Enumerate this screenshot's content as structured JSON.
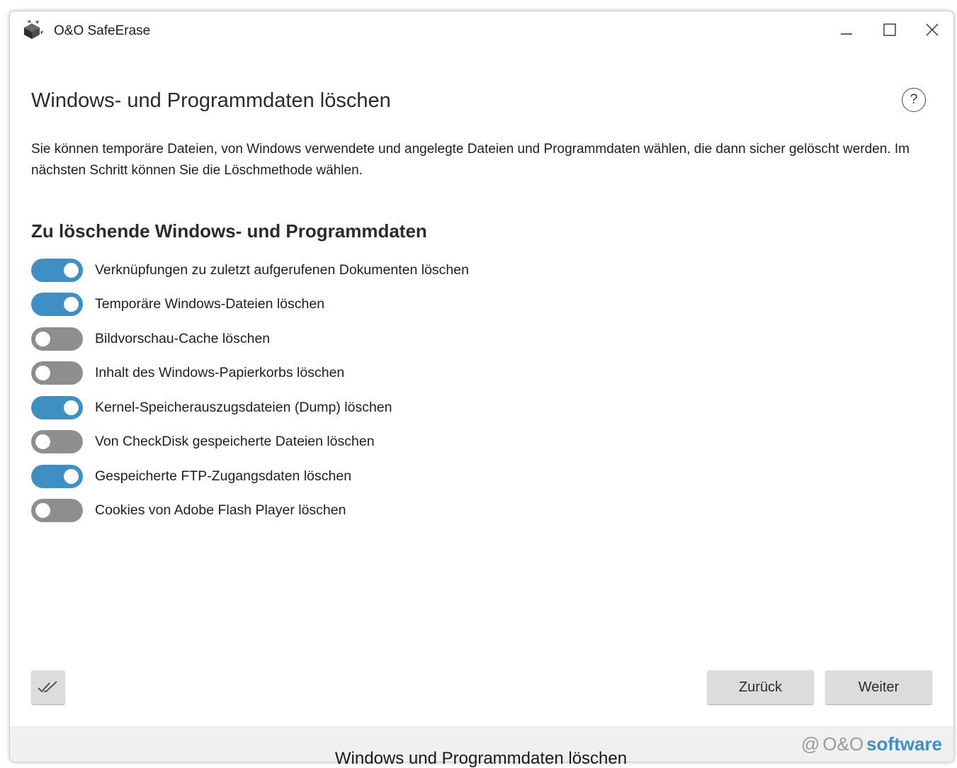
{
  "window": {
    "title": "O&O SafeErase",
    "controls": [
      "minimize",
      "maximize",
      "close"
    ]
  },
  "page": {
    "title": "Windows- und Programmdaten löschen",
    "help_symbol": "?",
    "description": "Sie können temporäre Dateien, von Windows verwendete und angelegte Dateien und Programmdaten wählen, die dann sicher gelöscht werden. Im nächsten Schritt können Sie die Löschmethode wählen.",
    "section_title": "Zu löschende Windows- und Programmdaten"
  },
  "options": [
    {
      "label": "Verknüpfungen zu zuletzt aufgerufenen Dokumenten löschen",
      "enabled": true
    },
    {
      "label": "Temporäre Windows-Dateien löschen",
      "enabled": true
    },
    {
      "label": "Bildvorschau-Cache löschen",
      "enabled": false
    },
    {
      "label": "Inhalt des Windows-Papierkorbs löschen",
      "enabled": false
    },
    {
      "label": "Kernel-Speicherauszugsdateien (Dump) löschen",
      "enabled": true
    },
    {
      "label": "Von CheckDisk gespeicherte Dateien löschen",
      "enabled": false
    },
    {
      "label": "Gespeicherte FTP-Zugangsdaten löschen",
      "enabled": true
    },
    {
      "label": "Cookies von Adobe Flash Player löschen",
      "enabled": false
    }
  ],
  "buttons": {
    "select_all_icon": "double-check-icon",
    "back": "Zurück",
    "next": "Weiter"
  },
  "footer": {
    "brand_mark": "@",
    "brand_oo": "O&O",
    "brand_software": "software"
  },
  "caption": "Windows und Programmdaten löschen",
  "colors": {
    "accent": "#3d8fc4",
    "toggle_off": "#8e8e8e",
    "button_bg": "#dcdcdc",
    "footer_bg": "#f0f0f0"
  }
}
